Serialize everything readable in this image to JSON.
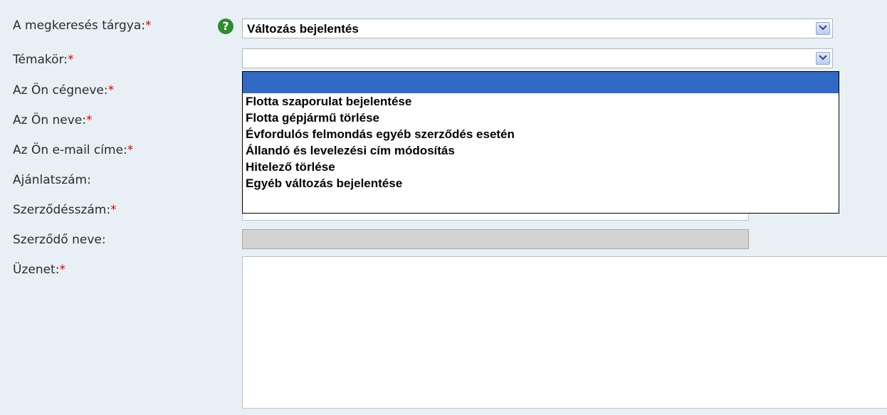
{
  "form": {
    "required_marker": "*",
    "help_icon_glyph": "?",
    "subject": {
      "label": "A megkeresés tárgya:",
      "value": "Változás bejelentés"
    },
    "topic": {
      "label": "Témakör:",
      "value": ""
    },
    "company": {
      "label": "Az Ön cégneve:"
    },
    "name": {
      "label": "Az Ön neve:"
    },
    "email": {
      "label": "Az Ön e-mail címe:"
    },
    "offer_number": {
      "label": "Ajánlatszám:"
    },
    "contract_number": {
      "label": "Szerződésszám:"
    },
    "contractor_name": {
      "label": "Szerződő neve:"
    },
    "message": {
      "label": "Üzenet:"
    }
  },
  "topic_dropdown": {
    "options": [
      "",
      "Flotta szaporulat bejelentése",
      "Flotta gépjármű törlése",
      "Évfordulós felmondás egyéb szerződés esetén",
      "Állandó és levelezési cím módosítás",
      "Hitelező törlése",
      "Egyéb változás bejelentése"
    ],
    "highlighted_index": 0
  },
  "icons": {
    "help": "help-icon",
    "arrow": "chevron-down-icon"
  },
  "colors": {
    "background": "#e9f0f5",
    "required": "#e00000",
    "help_icon": "#2e8b2e",
    "highlight": "#316ac5"
  }
}
